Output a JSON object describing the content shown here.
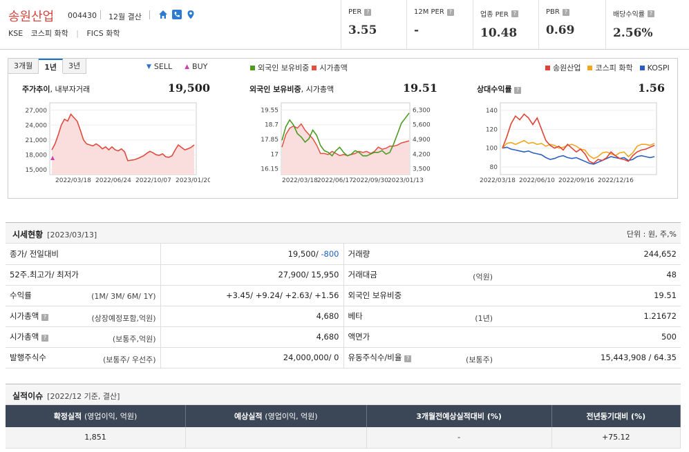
{
  "header": {
    "company": "송원산업",
    "code": "004430",
    "settlement": "12월 결산",
    "market": "KSE",
    "kospi_sector": "코스피 화학",
    "fics_sector": "FICS 화학",
    "icons": [
      "home-icon",
      "phone-icon",
      "location-icon"
    ],
    "metrics": [
      {
        "label": "PER",
        "value": "3.55"
      },
      {
        "label": "12M PER",
        "value": "-"
      },
      {
        "label": "업종 PER",
        "value": "10.48"
      },
      {
        "label": "PBR",
        "value": "0.69"
      },
      {
        "label": "배당수익률",
        "value": "2.56%"
      }
    ]
  },
  "chart_tabs": [
    "3개월",
    "1년",
    "3년"
  ],
  "legends": {
    "trade": [
      {
        "label": "SELL",
        "color": "#2b6fd0",
        "glyph": "▼"
      },
      {
        "label": "BUY",
        "color": "#cc44aa",
        "glyph": "▲"
      }
    ],
    "foreign": [
      {
        "label": "외국인 보유비중",
        "color": "#4c9a1f"
      },
      {
        "label": "시가총액",
        "color": "#e05040"
      }
    ],
    "relative": [
      {
        "label": "송원산업",
        "color": "#e04236"
      },
      {
        "label": "코스피 화학",
        "color": "#f2a51e"
      },
      {
        "label": "KOSPI",
        "color": "#2a5fbf"
      }
    ]
  },
  "panels": {
    "price": {
      "title": "주가추이",
      "subtitle": "내부자거래",
      "value": "19,500"
    },
    "foreign": {
      "title": "외국인 보유비중",
      "subtitle": "시가총액",
      "value": "19.51"
    },
    "relative": {
      "title": "상대수익률",
      "value": "1.56"
    }
  },
  "chart_data": [
    {
      "type": "area",
      "title": "주가추이",
      "x": [
        "2022/03/18",
        "2022/06/24",
        "2022/10/07",
        "2023/01/20"
      ],
      "y_ticks": [
        "27,000",
        "24,000",
        "21,000",
        "18,000",
        "15,000"
      ],
      "ylim": [
        14000,
        28500
      ],
      "series": [
        {
          "name": "주가",
          "values": [
            19000,
            20200,
            22000,
            24000,
            25200,
            24800,
            26200,
            25500,
            24800,
            23000,
            21000,
            20200,
            20000,
            19800,
            20200,
            19800,
            19200,
            19600,
            19000,
            19600,
            19000,
            18800,
            19200,
            18600,
            16800,
            16900,
            17000,
            17200,
            17500,
            17800,
            18300,
            18700,
            18400,
            18000,
            17900,
            18200,
            17600,
            17500,
            17800,
            19000,
            20000,
            19500,
            19000,
            19200,
            19500,
            20000
          ]
        }
      ]
    },
    {
      "type": "line",
      "title": "외국인 보유비중",
      "x": [
        "2022/03/18",
        "2022/06/17",
        "2022/09/30",
        "2023/01/13"
      ],
      "y_ticks_left": [
        "19.55",
        "18.7",
        "17.85",
        "17",
        "16.15"
      ],
      "y_ticks_right": [
        "6,300",
        "5,600",
        "4,900",
        "4,200",
        "3,500"
      ],
      "series": [
        {
          "name": "외국인 보유비중",
          "values": [
            17.9,
            18.7,
            19.1,
            18.8,
            18.3,
            18.1,
            17.8,
            18.0,
            18.5,
            18.2,
            17.6,
            17.3,
            17.2,
            17.0,
            17.3,
            17.5,
            17.2,
            17.0,
            17.1,
            17.3,
            17.2,
            17.0,
            17.0,
            17.1,
            17.2,
            17.2,
            17.3,
            17.1,
            17.2,
            17.7,
            18.3,
            18.9,
            19.2,
            19.5
          ]
        },
        {
          "name": "시가총액",
          "values": [
            4600,
            5200,
            5500,
            5600,
            5500,
            5700,
            5400,
            5200,
            5000,
            4700,
            4300,
            4300,
            4250,
            4400,
            4300,
            4200,
            4250,
            4200,
            4250,
            4300,
            4400,
            4350,
            4400,
            4300,
            4400,
            4600,
            4500,
            4550,
            4650,
            4650,
            4700,
            4800,
            4850,
            4900
          ]
        }
      ]
    },
    {
      "type": "line",
      "title": "상대수익률",
      "x": [
        "2022/03/18",
        "2022/06/10",
        "2022/09/16",
        "2022/12/16"
      ],
      "y_ticks": [
        "140",
        "120",
        "100",
        "80"
      ],
      "ylim": [
        72,
        148
      ],
      "series": [
        {
          "name": "송원산업",
          "values": [
            100,
            112,
            126,
            134,
            130,
            136,
            132,
            125,
            132,
            120,
            108,
            103,
            100,
            102,
            98,
            104,
            100,
            96,
            99,
            94,
            86,
            84,
            88,
            87,
            90,
            96,
            92,
            89,
            88,
            86,
            92,
            96,
            98,
            99,
            101,
            103
          ]
        },
        {
          "name": "코스피 화학",
          "values": [
            100,
            105,
            106,
            104,
            106,
            108,
            105,
            106,
            104,
            105,
            102,
            104,
            103,
            100,
            101,
            103,
            104,
            102,
            99,
            98,
            92,
            89,
            91,
            95,
            96,
            94,
            92,
            95,
            96,
            91,
            95,
            102,
            104,
            104,
            103,
            105
          ]
        },
        {
          "name": "KOSPI",
          "values": [
            100,
            101,
            99,
            98,
            97,
            96,
            97,
            95,
            94,
            93,
            90,
            88,
            89,
            91,
            92,
            90,
            89,
            90,
            88,
            86,
            84,
            83,
            85,
            87,
            89,
            91,
            90,
            89,
            90,
            87,
            88,
            91,
            92,
            91,
            90,
            91
          ]
        }
      ]
    }
  ],
  "market_section": {
    "title": "시세현황",
    "date": "[2023/03/13]",
    "unit": "단위 : 원, 주,%"
  },
  "market_rows": [
    {
      "k": "종가/ 전일대비",
      "k_sub": "",
      "v": "19,500/",
      "v_delta": "-800",
      "k2": "거래량",
      "k2_sub": "",
      "v2": "244,652"
    },
    {
      "k": "52주.최고가/ 최저가",
      "k_sub": "",
      "v": "27,900/ 15,950",
      "k2": "거래대금",
      "k2_sub": "(억원)",
      "v2": "48"
    },
    {
      "k": "수익률",
      "k_sub": "(1M/ 3M/ 6M/ 1Y)",
      "v_returns": "+3.45/ +9.24/ +2.63/ +1.56",
      "k2": "외국인 보유비중",
      "k2_sub": "",
      "v2": "19.51"
    },
    {
      "k": "시가총액",
      "k_sub": "(상장예정포함,억원)",
      "v": "4,680",
      "k2": "베타",
      "k2_sub": "(1년)",
      "v2": "1.21672"
    },
    {
      "k": "시가총액",
      "k_sub": "(보통주,억원)",
      "v": "4,680",
      "k2": "액면가",
      "k2_sub": "",
      "v2": "500"
    },
    {
      "k": "발행주식수",
      "k_sub": "(보통주/ 우선주)",
      "v": "24,000,000/ 0",
      "k2": "유동주식수/비율",
      "k2_sub": "(보통주)",
      "v2": "15,443,908 / 64.35"
    }
  ],
  "perf_section": {
    "title": "실적이슈",
    "date": "[2022/12 기준, 결산]"
  },
  "perf_table": {
    "headers": [
      {
        "b": "확정실적",
        "n": "(영업이익, 억원)"
      },
      {
        "b": "예상실적",
        "n": "(영업이익, 억원)"
      },
      {
        "b": "3개월전예상실적대비 (%)",
        "n": ""
      },
      {
        "b": "전년동기대비 (%)",
        "n": ""
      }
    ],
    "row": [
      "1,851",
      "",
      "-",
      "+75.12"
    ]
  }
}
